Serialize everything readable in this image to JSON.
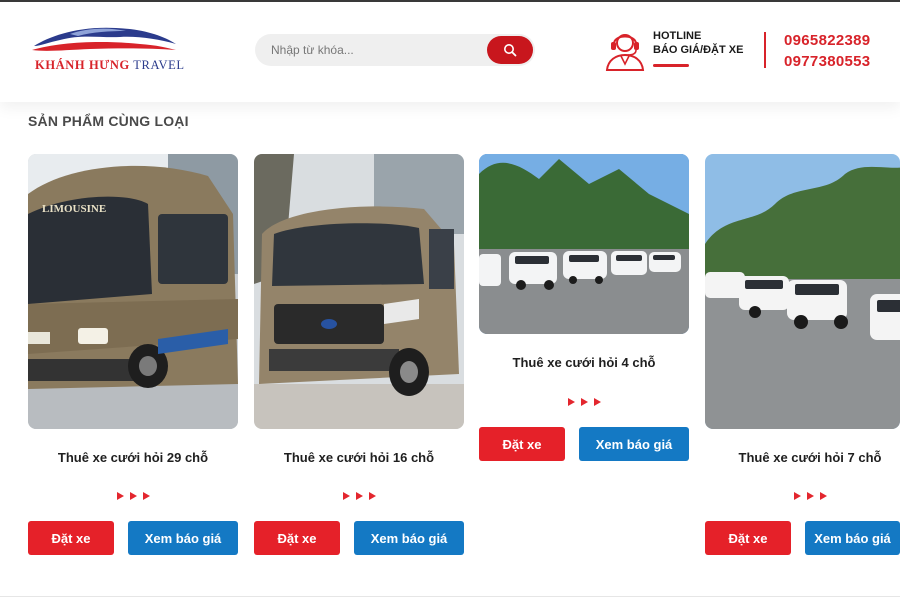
{
  "header": {
    "logo": {
      "brand": "KHÁNH HƯNG",
      "suffix": "TRAVEL"
    },
    "search": {
      "placeholder": "Nhập từ khóa..."
    },
    "hotline": {
      "title": "HOTLINE",
      "subtitle": "BÁO GIÁ/ĐẶT XE",
      "phones": [
        "0965822389",
        "0977380553"
      ]
    }
  },
  "colors": {
    "primary_red": "#e52129",
    "primary_blue": "#1479c4",
    "logo_blue": "#2b3b8c"
  },
  "section": {
    "title": "SẢN PHẨM CÙNG LOẠI",
    "products": [
      {
        "title": "Thuê xe cưới hỏi 29 chỗ",
        "book_label": "Đặt xe",
        "quote_label": "Xem báo giá",
        "image": "limousine-bus-photo"
      },
      {
        "title": "Thuê xe cưới hỏi 16 chỗ",
        "book_label": "Đặt xe",
        "quote_label": "Xem báo giá",
        "image": "ford-transit-van-photo"
      },
      {
        "title": "Thuê xe cưới hỏi 4 chỗ",
        "book_label": "Đặt xe",
        "quote_label": "Xem báo giá",
        "image": "white-sedans-row-photo"
      },
      {
        "title": "Thuê xe cưới hỏi 7 chỗ",
        "book_label": "Đặt xe",
        "quote_label": "Xem báo giá",
        "image": "white-suvs-row-photo"
      }
    ]
  }
}
